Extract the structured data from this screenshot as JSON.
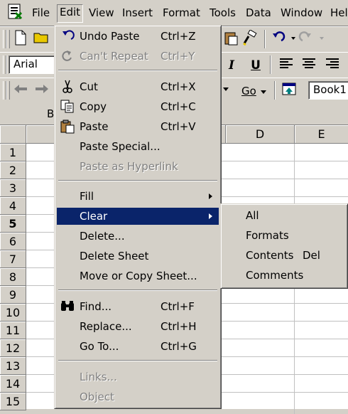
{
  "menubar": {
    "items": [
      "File",
      "Edit",
      "View",
      "Insert",
      "Format",
      "Tools",
      "Data",
      "Window",
      "Hel"
    ]
  },
  "toolbar_formatting": {
    "font_name": "Arial"
  },
  "toolbar_web": {
    "go_label": "Go",
    "address_value": "Book1"
  },
  "formulabar": {
    "cell_ref": "B"
  },
  "sheet": {
    "columns": [
      "D",
      "E"
    ],
    "rows": [
      "1",
      "2",
      "3",
      "4",
      "5",
      "6",
      "7",
      "8",
      "9",
      "10",
      "11",
      "12",
      "13",
      "14",
      "15"
    ],
    "active_row": "5"
  },
  "edit_menu": {
    "items": [
      {
        "label": "Undo Paste",
        "shortcut": "Ctrl+Z",
        "icon": "undo-icon",
        "disabled": false
      },
      {
        "label": "Can't Repeat",
        "shortcut": "Ctrl+Y",
        "icon": "repeat-icon",
        "disabled": true
      },
      {
        "label": "Cut",
        "shortcut": "Ctrl+X",
        "icon": "scissors-icon",
        "disabled": false
      },
      {
        "label": "Copy",
        "shortcut": "Ctrl+C",
        "icon": "copy-icon",
        "disabled": false
      },
      {
        "label": "Paste",
        "shortcut": "Ctrl+V",
        "icon": "paste-icon",
        "disabled": false
      },
      {
        "label": "Paste Special...",
        "shortcut": "",
        "disabled": false
      },
      {
        "label": "Paste as Hyperlink",
        "shortcut": "",
        "disabled": true
      },
      {
        "label": "Fill",
        "shortcut": "",
        "submenu": true,
        "disabled": false
      },
      {
        "label": "Clear",
        "shortcut": "",
        "submenu": true,
        "highlighted": true,
        "disabled": false
      },
      {
        "label": "Delete...",
        "shortcut": "",
        "disabled": false
      },
      {
        "label": "Delete Sheet",
        "shortcut": "",
        "disabled": false
      },
      {
        "label": "Move or Copy Sheet...",
        "shortcut": "",
        "disabled": false
      },
      {
        "label": "Find...",
        "shortcut": "Ctrl+F",
        "icon": "binoculars-icon",
        "disabled": false
      },
      {
        "label": "Replace...",
        "shortcut": "Ctrl+H",
        "disabled": false
      },
      {
        "label": "Go To...",
        "shortcut": "Ctrl+G",
        "disabled": false
      },
      {
        "label": "Links...",
        "shortcut": "",
        "disabled": true
      },
      {
        "label": "Object",
        "shortcut": "",
        "disabled": true
      }
    ]
  },
  "clear_submenu": {
    "items": [
      {
        "label": "All",
        "shortcut": ""
      },
      {
        "label": "Formats",
        "shortcut": ""
      },
      {
        "label": "Contents",
        "shortcut": "Del"
      },
      {
        "label": "Comments",
        "shortcut": ""
      }
    ]
  },
  "colors": {
    "highlight": "#0a246a",
    "face": "#d4d0c8"
  }
}
